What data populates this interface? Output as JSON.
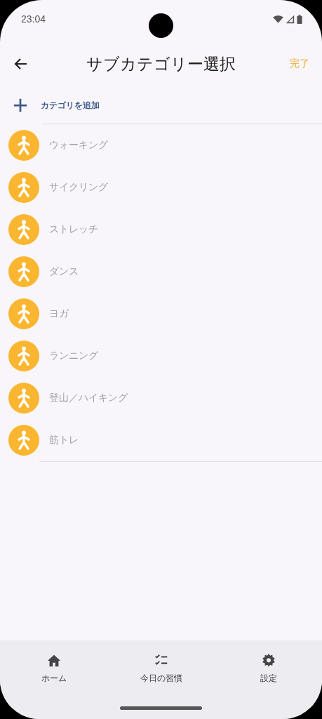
{
  "status_bar": {
    "time": "23:04"
  },
  "header": {
    "title": "サブカテゴリー選択",
    "done": "完了"
  },
  "add_row": {
    "label": "カテゴリを追加"
  },
  "subcategories": [
    {
      "name": "ウォーキング"
    },
    {
      "name": "サイクリング"
    },
    {
      "name": "ストレッチ"
    },
    {
      "name": "ダンス"
    },
    {
      "name": "ヨガ"
    },
    {
      "name": "ランニング"
    },
    {
      "name": "登山／ハイキング"
    },
    {
      "name": "筋トレ"
    }
  ],
  "bottom_nav": [
    {
      "kind": "home",
      "label": "ホーム",
      "selected": false
    },
    {
      "kind": "checklist",
      "label": "今日の習慣",
      "selected": false
    },
    {
      "kind": "settings",
      "label": "設定",
      "selected": false
    }
  ]
}
